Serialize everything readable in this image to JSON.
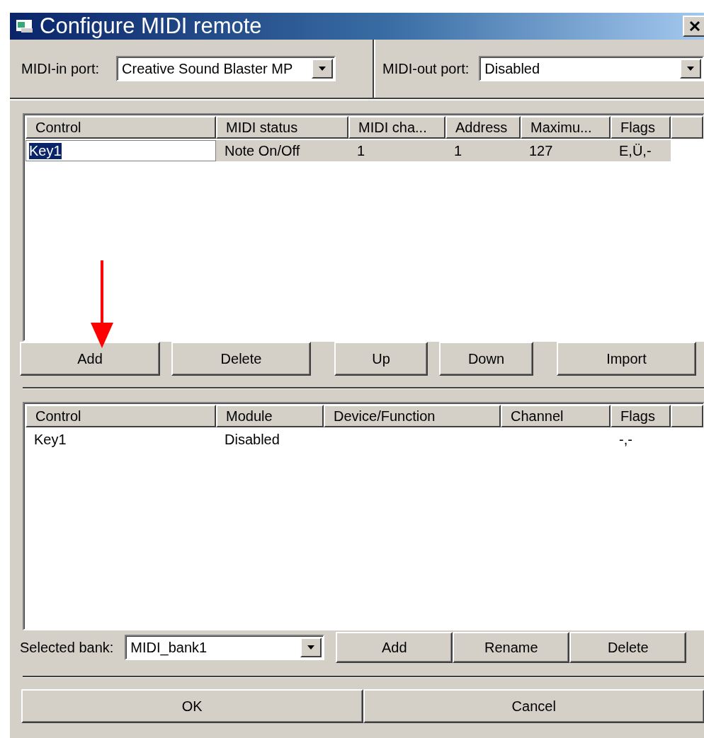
{
  "window": {
    "title": "Configure MIDI remote"
  },
  "midi_in": {
    "label": "MIDI-in port:",
    "value": "Creative Sound Blaster MP"
  },
  "midi_out": {
    "label": "MIDI-out port:",
    "value": "Disabled"
  },
  "mappings_table": {
    "columns": [
      "Control",
      "MIDI status",
      "MIDI cha...",
      "Address",
      "Maximu...",
      "Flags"
    ],
    "rows": [
      {
        "cells": [
          "Key1",
          "Note On/Off",
          "1",
          "1",
          "127",
          "E,Ü,-"
        ],
        "selected": true,
        "editing": true
      }
    ]
  },
  "mapping_buttons": [
    "Add",
    "Delete",
    "Up",
    "Down",
    "Import"
  ],
  "assignments_table": {
    "columns": [
      "Control",
      "Module",
      "Device/Function",
      "Channel",
      "Flags"
    ],
    "rows": [
      {
        "cells": [
          "Key1",
          "Disabled",
          null,
          null,
          "-,-"
        ],
        "selected": false,
        "editing": false
      }
    ]
  },
  "bank": {
    "label": "Selected bank:",
    "value": "MIDI_bank1"
  },
  "bank_buttons": [
    "Add",
    "Rename",
    "Delete"
  ],
  "dialog_buttons": [
    "OK",
    "Cancel"
  ]
}
